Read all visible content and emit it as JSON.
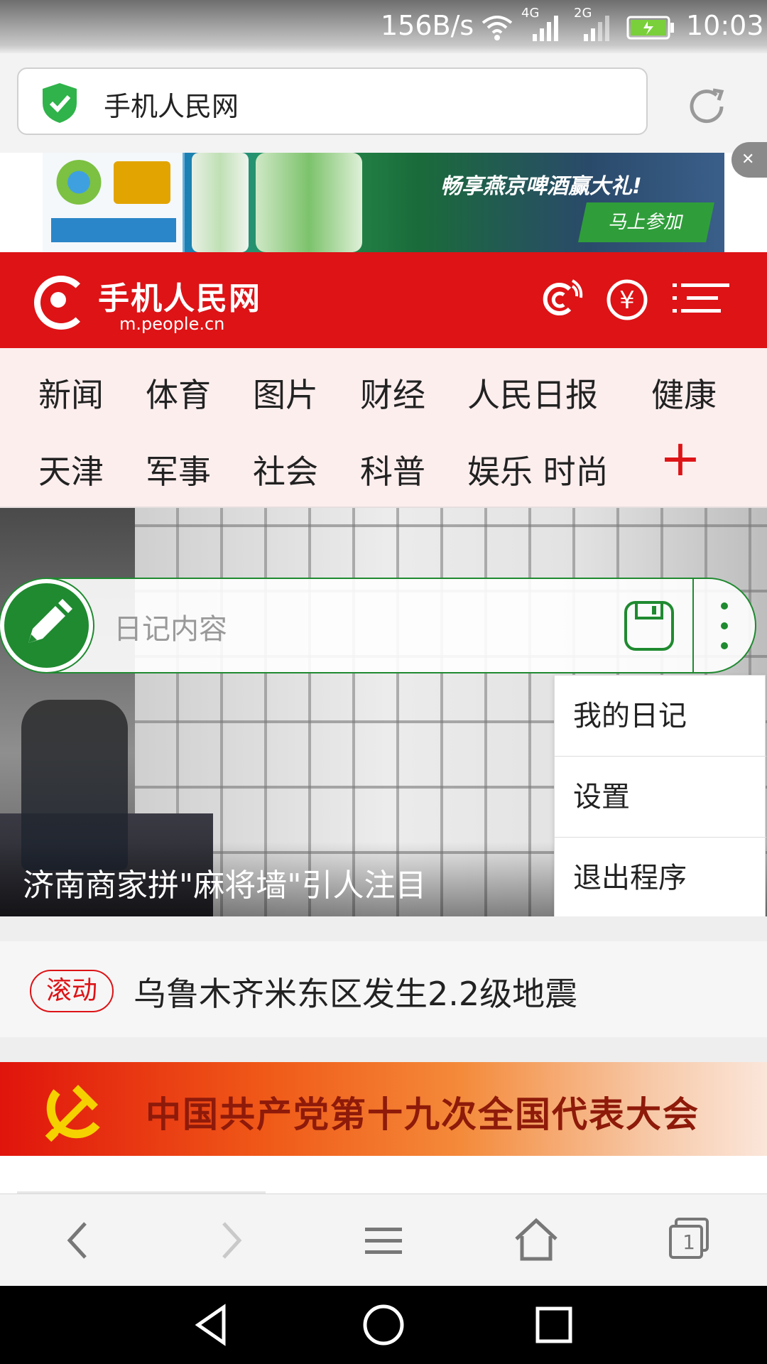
{
  "status_bar": {
    "net_speed": "156B/s",
    "signal1_label": "4G",
    "signal2_label": "2G",
    "time": "10:03"
  },
  "address_bar": {
    "url_text": "手机人民网",
    "secure_icon": "shield-check-icon",
    "reload_icon": "reload-icon"
  },
  "ad_banner": {
    "slogan": "畅享燕京啤酒赢大礼!",
    "cta": "马上参加"
  },
  "site_header": {
    "logo_name": "手机人民网",
    "logo_domain": "m.people.cn",
    "icons": [
      "comment-icon",
      "yuan-icon",
      "menu-icon"
    ]
  },
  "categories": {
    "row1": [
      "新闻",
      "体育",
      "图片",
      "财经",
      "人民日报",
      "健康"
    ],
    "row2": [
      "天津",
      "军事",
      "社会",
      "科普",
      "娱乐 时尚"
    ]
  },
  "hero": {
    "caption": "济南商家拼\"麻将墙\"引人注目"
  },
  "diary_widget": {
    "placeholder": "日记内容"
  },
  "popup_menu": {
    "items": [
      "我的日记",
      "设置",
      "退出程序"
    ]
  },
  "news_ticker": {
    "tag": "滚动",
    "headline": "乌鲁木齐米东区发生2.2级地震"
  },
  "party_banner": {
    "title": "中国共产党第十九次全国代表大会"
  },
  "toolbar": {
    "tabs_count": "1"
  },
  "colors": {
    "brand_red": "#dd1316",
    "diary_green": "#1f8a30"
  }
}
